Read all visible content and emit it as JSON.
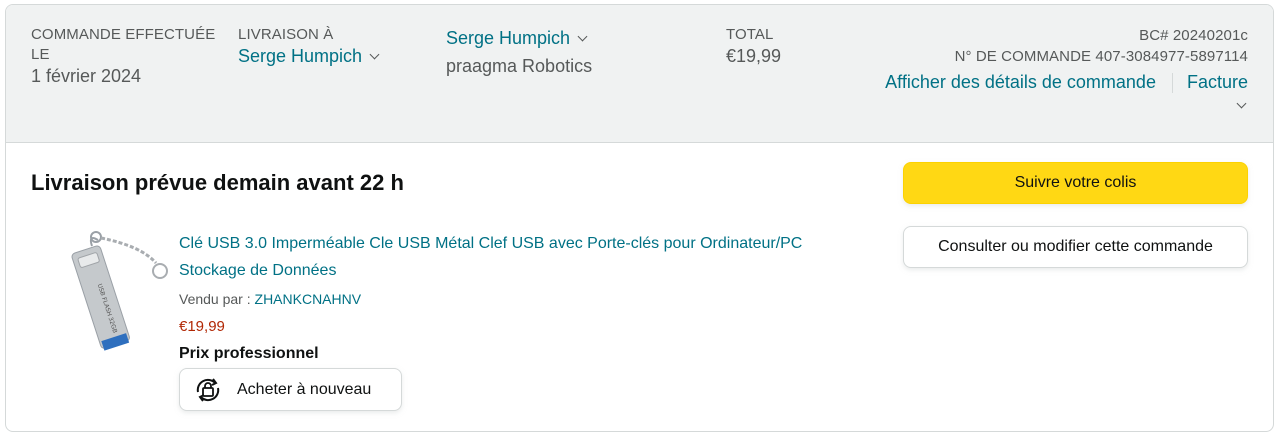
{
  "header": {
    "order_placed_label": "COMMANDE EFFECTUÉE LE",
    "order_date": "1 février 2024",
    "ship_to_label": "LIVRAISON À",
    "ship_to_name": "Serge Humpich",
    "other_name": "Serge Humpich",
    "company": "praagma Robotics",
    "total_label": "TOTAL",
    "total_value": "€19,99",
    "po_number": "BC# 20240201c",
    "order_number": "N° DE COMMANDE 407-3084977-5897114",
    "details_link": "Afficher des détails de commande",
    "invoice_link": "Facture"
  },
  "shipment": {
    "status_title": "Livraison prévue demain avant 22 h",
    "track_button": "Suivre votre colis",
    "manage_button": "Consulter ou modifier cette commande"
  },
  "product": {
    "title": "Clé USB 3.0 Imperméable Cle USB Métal Clef USB avec Porte-clés pour Ordinateur/PC Stockage de Données",
    "sold_by_label": "Vendu par : ",
    "seller": "ZHANKCNAHNV",
    "price": "€19,99",
    "price_type": "Prix professionnel",
    "buy_again": "Acheter à nouveau",
    "image_text": "USB FLASH",
    "image_capacity": "32GB"
  },
  "colors": {
    "link": "#007185",
    "primary_button": "#FFD814",
    "price": "#B12704",
    "header_bg": "#F0F2F2"
  },
  "icons": [
    "chevron-down-icon",
    "buy-again-icon"
  ]
}
